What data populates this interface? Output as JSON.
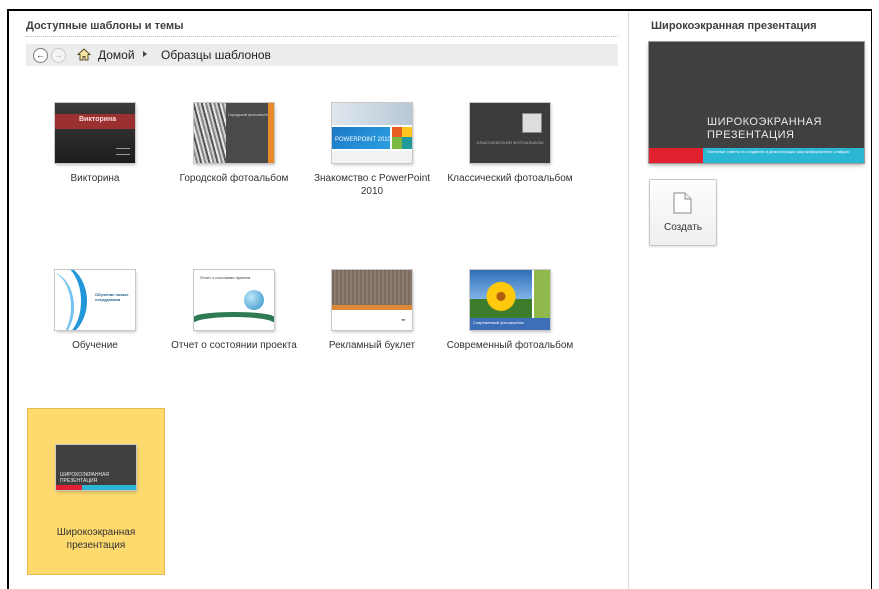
{
  "main": {
    "section_title": "Доступные шаблоны и темы",
    "breadcrumb": {
      "home": "Домой",
      "current": "Образцы шаблонов"
    },
    "templates": [
      {
        "label": "Викторина",
        "thumb_text": "Викторина"
      },
      {
        "label": "Городской фотоальбом",
        "thumb_text": "Городской фотоальбом"
      },
      {
        "label": "Знакомство с PowerPoint 2010",
        "thumb_text": "POWERPOINT 2010"
      },
      {
        "label": "Классический фотоальбом",
        "thumb_text": "КЛАССИЧЕСКИЙ ФОТОАЛЬБОМ"
      },
      {
        "label": "Обучение",
        "thumb_text": "Обучение новых сотрудников"
      },
      {
        "label": "Отчет о состоянии проекта",
        "thumb_text": "Отчет о состоянии проекта"
      },
      {
        "label": "Рекламный буклет",
        "thumb_text": ""
      },
      {
        "label": "Современный фотоальбом",
        "thumb_text": "Современный фотоальбом"
      },
      {
        "label": "Широкоэкранная презентация",
        "thumb_text": "ШИРОКОЭКРАННАЯ ПРЕЗЕНТАЦИЯ",
        "selected": true
      }
    ]
  },
  "sidebar": {
    "title": "Широкоэкранная презентация",
    "preview_title": "ШИРОКОЭКРАННАЯ ПРЕЗЕНТАЦИЯ",
    "preview_subtitle": "Полезные советы по созданию и демонстрации широкоформатных слайдов",
    "create_label": "Создать"
  },
  "colors": {
    "selected_tile": "#fdd96e",
    "accent_red": "#e02230",
    "accent_teal": "#2bb6d3",
    "slide_dark": "#404040"
  }
}
